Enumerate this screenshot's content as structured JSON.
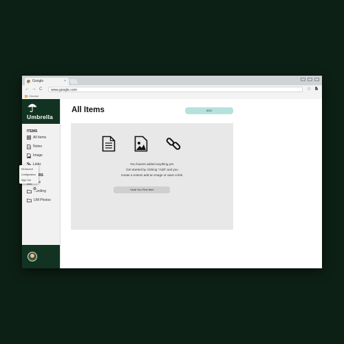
{
  "browser": {
    "tab_title": "Google",
    "tab_close": "×",
    "address": "www.google.com",
    "bookmark": "Chrome",
    "nav_back": "←",
    "nav_forward": "→",
    "nav_reload": "C",
    "star": "☆"
  },
  "sidebar": {
    "brand": "Umbrella",
    "items_heading": "ITEMS",
    "items": [
      {
        "label": "All Items",
        "icon": "grid-icon"
      },
      {
        "label": "Notes",
        "icon": "note-icon"
      },
      {
        "label": "Image",
        "icon": "image-icon"
      },
      {
        "label": "Links",
        "icon": "link-icon"
      }
    ],
    "folders_heading": "FOLDERS",
    "folders": [
      {
        "label": "New",
        "icon": "folder-icon"
      },
      {
        "label": "Landing",
        "icon": "folder-icon"
      },
      {
        "label": "UM Photos",
        "icon": "folder-icon"
      }
    ]
  },
  "user_menu": {
    "items": [
      "Mi Account",
      "Configuration",
      "Sign Out"
    ],
    "gear": "⚙"
  },
  "main": {
    "title": "All Items",
    "add_button": "ADD",
    "empty_lines": [
      "You havent added anything yet.",
      "Get started by clicking \"Add\" and you",
      "create a notens add an image or save a link."
    ],
    "add_first_button": "+Add You First Item"
  },
  "colors": {
    "background": "#0d2016",
    "brand": "#123321",
    "accent": "#b5e3dc",
    "panel": "#e8e8e8"
  }
}
